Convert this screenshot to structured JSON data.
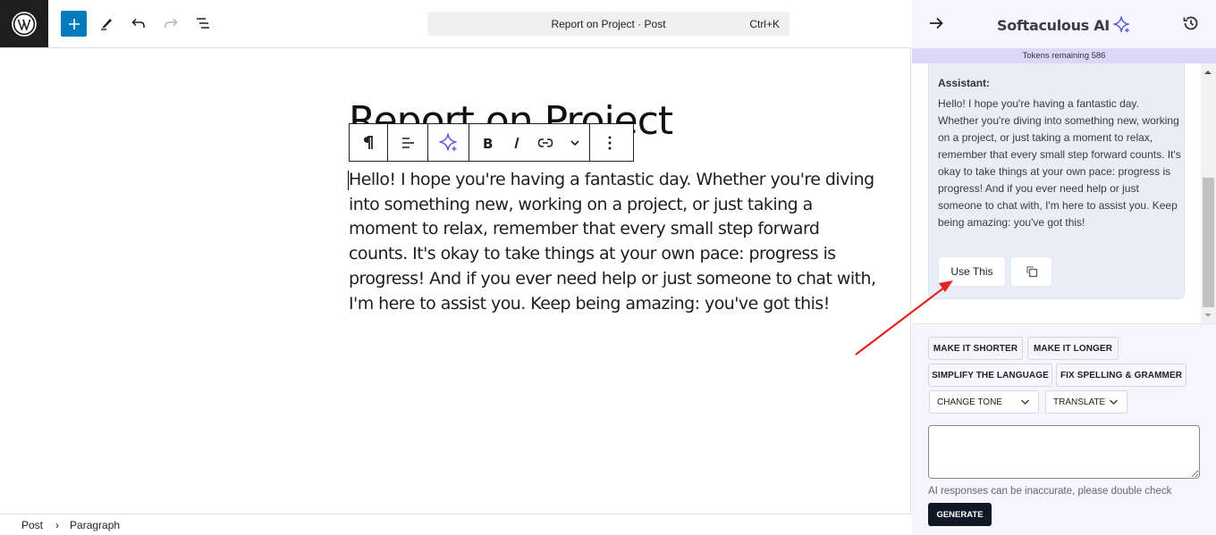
{
  "topbar": {
    "logo": "wordpress-logo",
    "buttons": [
      "add-block",
      "tools-edit",
      "undo",
      "redo",
      "document-overview"
    ],
    "command_bar": {
      "title": "Report on Project · Post",
      "shortcut": "Ctrl+K"
    }
  },
  "editor": {
    "post_title": "Report on Project",
    "paragraph": "Hello! I hope you're having a fantastic day. Whether you're diving into something new, working on a project, or just taking a moment to relax, remember that every small step forward counts. It's okay to take things at your own pace: progress is progress! And if you ever need help or just someone to chat with, I'm here to assist you. Keep being amazing: you've got this!",
    "block_toolbar": [
      "paragraph",
      "align",
      "ai-sparkle",
      "bold",
      "italic",
      "link",
      "more-rich-text",
      "options"
    ]
  },
  "footer": {
    "breadcrumbs": [
      "Post",
      "Paragraph"
    ],
    "separator": "›"
  },
  "sidebar": {
    "title": "Softaculous AI",
    "tokens_label": "Tokens remaining 586",
    "message": {
      "role": "Assistant:",
      "text": "Hello! I hope you're having a fantastic day. Whether you're diving into something new, working on a project, or just taking a moment to relax, remember that every small step forward counts. It's okay to take things at your own pace: progress is progress! And if you ever need help or just someone to chat with, I'm here to assist you. Keep being amazing: you've got this!",
      "use_label": "Use This"
    },
    "actions": {
      "make_shorter": "MAKE IT SHORTER",
      "make_longer": "MAKE IT LONGER",
      "simplify": "SIMPLIFY THE LANGUAGE",
      "fix_spelling": "FIX SPELLING & GRAMMER",
      "change_tone": "CHANGE TONE",
      "translate": "TRANSLATE"
    },
    "prompt": {
      "value": "",
      "placeholder": ""
    },
    "disclaimer": "AI responses can be inaccurate, please double check",
    "generate_label": "GENERATE"
  },
  "colors": {
    "wp_blue": "#007cba",
    "ai_accent": "#5b5bd6",
    "annotation_arrow": "#e8201e",
    "generate_bg": "#101828"
  }
}
